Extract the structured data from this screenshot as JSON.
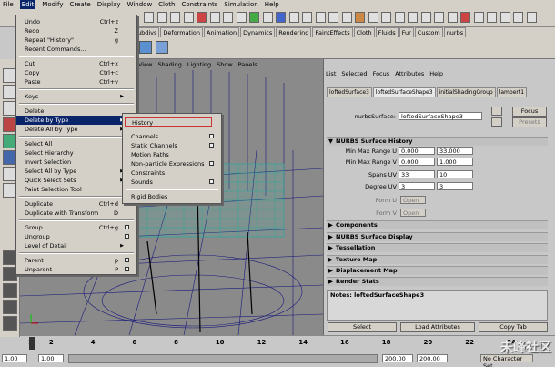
{
  "menubar": [
    "File",
    "Edit",
    "Modify",
    "Create",
    "Display",
    "Window",
    "Cloth",
    "Constraints",
    "Simulation",
    "Help"
  ],
  "shelf_tabs": [
    "ubdivs",
    "Deformation",
    "Animation",
    "Dynamics",
    "Rendering",
    "PaintEffects",
    "Cloth",
    "Fluids",
    "Fur",
    "Custom",
    "nurbs"
  ],
  "edit_menu": {
    "undo": {
      "label": "Undo",
      "shortcut": "Ctrl+z"
    },
    "redo": {
      "label": "Redo",
      "shortcut": "Z"
    },
    "repeat": {
      "label": "Repeat \"History\"",
      "shortcut": "g"
    },
    "recent": {
      "label": "Recent Commands..."
    },
    "cut": {
      "label": "Cut",
      "shortcut": "Ctrl+x"
    },
    "copy": {
      "label": "Copy",
      "shortcut": "Ctrl+c"
    },
    "paste": {
      "label": "Paste",
      "shortcut": "Ctrl+v"
    },
    "keys": {
      "label": "Keys"
    },
    "delete": {
      "label": "Delete"
    },
    "delete_by_type": {
      "label": "Delete by Type"
    },
    "delete_all_by_type": {
      "label": "Delete All by Type"
    },
    "select_all": {
      "label": "Select All"
    },
    "select_hierarchy": {
      "label": "Select Hierarchy"
    },
    "invert_selection": {
      "label": "Invert Selection"
    },
    "select_all_by_type": {
      "label": "Select All by Type"
    },
    "quick_select_sets": {
      "label": "Quick Select Sets"
    },
    "paint_selection_tool": {
      "label": "Paint Selection Tool"
    },
    "duplicate": {
      "label": "Duplicate",
      "shortcut": "Ctrl+d"
    },
    "duplicate_transform": {
      "label": "Duplicate with Transform",
      "shortcut": "D"
    },
    "group": {
      "label": "Group",
      "shortcut": "Ctrl+g"
    },
    "ungroup": {
      "label": "Ungroup"
    },
    "level_of_detail": {
      "label": "Level of Detail"
    },
    "parent": {
      "label": "Parent",
      "shortcut": "p"
    },
    "unparent": {
      "label": "Unparent",
      "shortcut": "P"
    }
  },
  "submenu": {
    "history": "History",
    "channels": "Channels",
    "static_channels": "Static Channels",
    "motion_paths": "Motion Paths",
    "non_particle": "Non-particle Expressions",
    "constraints": "Constraints",
    "sounds": "Sounds",
    "rigid_bodies": "Rigid Bodies"
  },
  "view_menu": [
    "View",
    "Shading",
    "Lighting",
    "Show",
    "Panels"
  ],
  "channel_menu": [
    "List",
    "Selected",
    "Focus",
    "Attributes",
    "Help"
  ],
  "channel_tabs": [
    "loftedSurface3",
    "loftedSurfaceShape3",
    "initialShadingGroup",
    "lambert1"
  ],
  "node": {
    "label": "nurbsSurface:",
    "value": "loftedSurfaceShape3",
    "focus": "Focus",
    "presets": "Presets"
  },
  "history": {
    "title": "NURBS Surface History",
    "rows": [
      {
        "label": "Min Max Range U",
        "a": "0.000",
        "b": "33.000"
      },
      {
        "label": "Min Max Range V",
        "a": "0.000",
        "b": "1.000"
      },
      {
        "label": "Spans UV",
        "a": "33",
        "b": "10"
      },
      {
        "label": "Degree UV",
        "a": "3",
        "b": "3"
      }
    ],
    "form_u": {
      "label": "Form U",
      "value": "Open"
    },
    "form_v": {
      "label": "Form V",
      "value": "Open"
    }
  },
  "sections": [
    "Components",
    "NURBS Surface Display",
    "Tessellation",
    "Texture Map",
    "Displacement Map",
    "Render Stats"
  ],
  "notes": "Notes:  loftedSurfaceShape3",
  "bottom_buttons": {
    "select": "Select",
    "load": "Load Attributes",
    "copy_tab": "Copy Tab"
  },
  "timeline_ticks": [
    "1",
    "2",
    "4",
    "6",
    "8",
    "10",
    "12",
    "14",
    "16",
    "18",
    "20",
    "22",
    "24"
  ],
  "range": {
    "start": "1.00",
    "start2": "1.00",
    "end": "200.00",
    "end2": "200.00",
    "char_set": "No Character Set"
  },
  "watermark": "未峰社区"
}
